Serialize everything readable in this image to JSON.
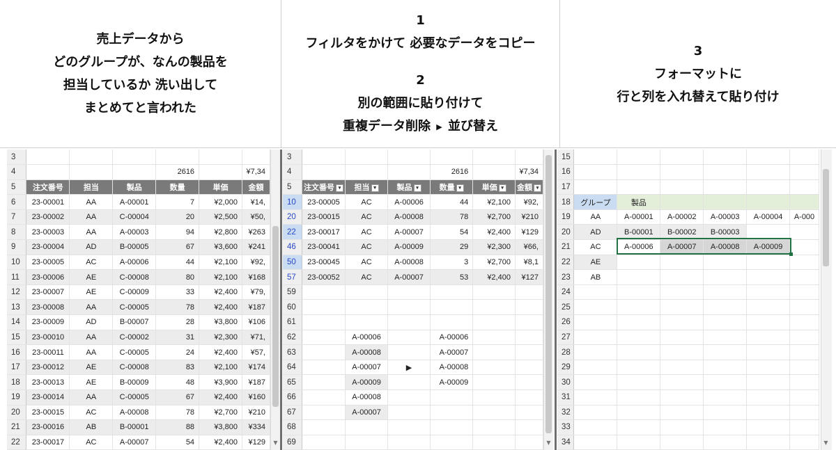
{
  "panel1": {
    "text": [
      "売上データから",
      "どのグループが、なんの製品を",
      "担当しているか 洗い出して",
      "まとめてと言われた"
    ]
  },
  "panel2": {
    "num1": "1",
    "text1": "フィルタをかけて 必要なデータをコピー",
    "num2": "2",
    "text2": "別の範囲に貼り付けて",
    "text3a": "重複データ削除",
    "text3b": "並び替え"
  },
  "panel3": {
    "num": "3",
    "text": [
      "フォーマットに",
      "行と列を入れ替えて貼り付け"
    ]
  },
  "sheet1": {
    "rows": [
      {
        "n": "3",
        "c": [
          "",
          "",
          "",
          "",
          "",
          ""
        ]
      },
      {
        "n": "4",
        "c": [
          "",
          "",
          "",
          "2616",
          "",
          "¥7,34"
        ]
      },
      {
        "n": "5",
        "c": [
          "注文番号",
          "担当",
          "製品",
          "数量",
          "単価",
          "金額"
        ],
        "header": true
      },
      {
        "n": "6",
        "c": [
          "23-00001",
          "AA",
          "A-00001",
          "7",
          "¥2,000",
          "¥14,"
        ]
      },
      {
        "n": "7",
        "c": [
          "23-00002",
          "AA",
          "C-00004",
          "20",
          "¥2,500",
          "¥50,"
        ]
      },
      {
        "n": "8",
        "c": [
          "23-00003",
          "AA",
          "A-00003",
          "94",
          "¥2,800",
          "¥263"
        ]
      },
      {
        "n": "9",
        "c": [
          "23-00004",
          "AD",
          "B-00005",
          "67",
          "¥3,600",
          "¥241"
        ]
      },
      {
        "n": "10",
        "c": [
          "23-00005",
          "AC",
          "A-00006",
          "44",
          "¥2,100",
          "¥92,"
        ]
      },
      {
        "n": "11",
        "c": [
          "23-00006",
          "AE",
          "C-00008",
          "80",
          "¥2,100",
          "¥168"
        ]
      },
      {
        "n": "12",
        "c": [
          "23-00007",
          "AE",
          "C-00009",
          "33",
          "¥2,400",
          "¥79,"
        ]
      },
      {
        "n": "13",
        "c": [
          "23-00008",
          "AA",
          "C-00005",
          "78",
          "¥2,400",
          "¥187"
        ]
      },
      {
        "n": "14",
        "c": [
          "23-00009",
          "AD",
          "B-00007",
          "28",
          "¥3,800",
          "¥106"
        ]
      },
      {
        "n": "15",
        "c": [
          "23-00010",
          "AA",
          "C-00002",
          "31",
          "¥2,300",
          "¥71,"
        ]
      },
      {
        "n": "16",
        "c": [
          "23-00011",
          "AA",
          "C-00005",
          "24",
          "¥2,400",
          "¥57,"
        ]
      },
      {
        "n": "17",
        "c": [
          "23-00012",
          "AE",
          "C-00008",
          "83",
          "¥2,100",
          "¥174"
        ]
      },
      {
        "n": "18",
        "c": [
          "23-00013",
          "AE",
          "B-00009",
          "48",
          "¥3,900",
          "¥187"
        ]
      },
      {
        "n": "19",
        "c": [
          "23-00014",
          "AA",
          "C-00005",
          "67",
          "¥2,400",
          "¥160"
        ]
      },
      {
        "n": "20",
        "c": [
          "23-00015",
          "AC",
          "A-00008",
          "78",
          "¥2,700",
          "¥210"
        ]
      },
      {
        "n": "21",
        "c": [
          "23-00016",
          "AB",
          "B-00001",
          "88",
          "¥3,800",
          "¥334"
        ]
      },
      {
        "n": "22",
        "c": [
          "23-00017",
          "AC",
          "A-00007",
          "54",
          "¥2,400",
          "¥129"
        ]
      }
    ]
  },
  "sheet2": {
    "rows": [
      {
        "n": "3",
        "c": [
          "",
          "",
          "",
          "",
          "",
          ""
        ]
      },
      {
        "n": "4",
        "c": [
          "",
          "",
          "",
          "2616",
          "",
          "¥7,34"
        ]
      },
      {
        "n": "5",
        "c": [
          "注文番号",
          "担当",
          "製品",
          "数量",
          "単価",
          "金額"
        ],
        "header": true
      },
      {
        "n": "10",
        "c": [
          "23-00005",
          "AC",
          "A-00006",
          "44",
          "¥2,100",
          "¥92,"
        ],
        "blue": true
      },
      {
        "n": "20",
        "c": [
          "23-00015",
          "AC",
          "A-00008",
          "78",
          "¥2,700",
          "¥210"
        ],
        "blue": true
      },
      {
        "n": "22",
        "c": [
          "23-00017",
          "AC",
          "A-00007",
          "54",
          "¥2,400",
          "¥129"
        ],
        "blue": true
      },
      {
        "n": "46",
        "c": [
          "23-00041",
          "AC",
          "A-00009",
          "29",
          "¥2,300",
          "¥66,"
        ],
        "blue": true
      },
      {
        "n": "50",
        "c": [
          "23-00045",
          "AC",
          "A-00008",
          "3",
          "¥2,700",
          "¥8,1"
        ],
        "blue": true
      },
      {
        "n": "57",
        "c": [
          "23-00052",
          "AC",
          "A-00007",
          "53",
          "¥2,400",
          "¥127"
        ],
        "blue": true
      },
      {
        "n": "59",
        "c": [
          "",
          "",
          "",
          "",
          "",
          ""
        ]
      },
      {
        "n": "60",
        "c": [
          "",
          "",
          "",
          "",
          "",
          ""
        ]
      },
      {
        "n": "61",
        "c": [
          "",
          "",
          "",
          "",
          "",
          ""
        ]
      },
      {
        "n": "62",
        "c": [
          "",
          "A-00006",
          "",
          "A-00006",
          "",
          ""
        ]
      },
      {
        "n": "63",
        "c": [
          "",
          "A-00008",
          "",
          "A-00007",
          "",
          ""
        ]
      },
      {
        "n": "64",
        "c": [
          "",
          "A-00007",
          "▶",
          "A-00008",
          "",
          ""
        ]
      },
      {
        "n": "65",
        "c": [
          "",
          "A-00009",
          "",
          "A-00009",
          "",
          ""
        ]
      },
      {
        "n": "66",
        "c": [
          "",
          "A-00008",
          "",
          "",
          "",
          ""
        ]
      },
      {
        "n": "67",
        "c": [
          "",
          "A-00007",
          "",
          "",
          "",
          ""
        ]
      },
      {
        "n": "68",
        "c": [
          "",
          "",
          "",
          "",
          "",
          ""
        ]
      },
      {
        "n": "69",
        "c": [
          "",
          "",
          "",
          "",
          "",
          ""
        ]
      }
    ]
  },
  "sheet3": {
    "rows": [
      {
        "n": "15",
        "c": [
          "",
          "",
          "",
          "",
          "",
          ""
        ]
      },
      {
        "n": "16",
        "c": [
          "",
          "",
          "",
          "",
          "",
          ""
        ]
      },
      {
        "n": "17",
        "c": [
          "",
          "",
          "",
          "",
          "",
          ""
        ]
      },
      {
        "n": "18",
        "c": [
          "グループ",
          "製品",
          "",
          "",
          "",
          ""
        ]
      },
      {
        "n": "19",
        "c": [
          "AA",
          "A-00001",
          "A-00002",
          "A-00003",
          "A-00004",
          "A-000"
        ]
      },
      {
        "n": "20",
        "c": [
          "AD",
          "B-00001",
          "B-00002",
          "B-00003",
          "",
          ""
        ]
      },
      {
        "n": "21",
        "c": [
          "AC",
          "A-00006",
          "A-00007",
          "A-00008",
          "A-00009",
          ""
        ]
      },
      {
        "n": "22",
        "c": [
          "AE",
          "",
          "",
          "",
          "",
          ""
        ]
      },
      {
        "n": "23",
        "c": [
          "AB",
          "",
          "",
          "",
          "",
          ""
        ]
      },
      {
        "n": "24",
        "c": [
          "",
          "",
          "",
          "",
          "",
          ""
        ]
      },
      {
        "n": "25",
        "c": [
          "",
          "",
          "",
          "",
          "",
          ""
        ]
      },
      {
        "n": "26",
        "c": [
          "",
          "",
          "",
          "",
          "",
          ""
        ]
      },
      {
        "n": "27",
        "c": [
          "",
          "",
          "",
          "",
          "",
          ""
        ]
      },
      {
        "n": "28",
        "c": [
          "",
          "",
          "",
          "",
          "",
          ""
        ]
      },
      {
        "n": "29",
        "c": [
          "",
          "",
          "",
          "",
          "",
          ""
        ]
      },
      {
        "n": "30",
        "c": [
          "",
          "",
          "",
          "",
          "",
          ""
        ]
      },
      {
        "n": "31",
        "c": [
          "",
          "",
          "",
          "",
          "",
          ""
        ]
      },
      {
        "n": "32",
        "c": [
          "",
          "",
          "",
          "",
          "",
          ""
        ]
      },
      {
        "n": "33",
        "c": [
          "",
          "",
          "",
          "",
          "",
          ""
        ]
      },
      {
        "n": "34",
        "c": [
          "",
          "",
          "",
          "",
          "",
          ""
        ]
      }
    ]
  }
}
